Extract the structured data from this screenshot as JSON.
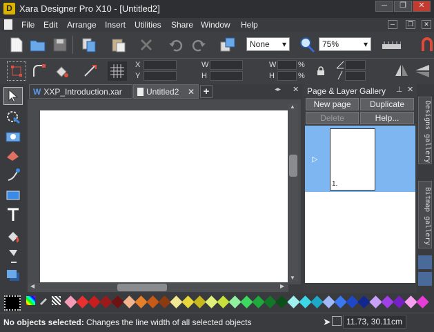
{
  "window": {
    "title": "Xara Designer Pro X10 - [Untitled2]",
    "app_icon": "D",
    "minimize": "─",
    "restore": "❐",
    "close": "✕",
    "inner_minimize": "─",
    "inner_restore": "❐",
    "inner_close": "✕"
  },
  "menu": [
    "File",
    "Edit",
    "Arrange",
    "Insert",
    "Utilities",
    "Share",
    "Window",
    "Help"
  ],
  "toolbar": {
    "quality_value": "None",
    "zoom_value": "75%"
  },
  "infobar": {
    "x_label": "X",
    "y_label": "Y",
    "w_label": "W",
    "h_label": "H",
    "w2_label": "W",
    "h2_label": "H",
    "pct1": "%",
    "pct2": "%"
  },
  "tabs": [
    {
      "label": "XXP_Introduction.xar",
      "icon": "W"
    },
    {
      "label": "Untitled2"
    }
  ],
  "tab_close": "✕",
  "tab_add": "+",
  "gallery": {
    "title": "Page & Layer Gallery",
    "new_page": "New page",
    "duplicate": "Duplicate",
    "delete": "Delete",
    "help": "Help...",
    "page_number": "1."
  },
  "vtabs": [
    "Designs gallery",
    "Bitmap gallery"
  ],
  "status": {
    "bold": "No objects selected:",
    "text": " Changes the line width of all selected objects",
    "coords": "11.73, 30.11cm"
  },
  "palette": [
    "#f49bb8",
    "#e83030",
    "#c81e1e",
    "#9c1a1a",
    "#6e1212",
    "#f2b48c",
    "#e8802a",
    "#c85a18",
    "#8c3a10",
    "#f2e894",
    "#e8d83c",
    "#c8b81e",
    "#e0f07a",
    "#c8e03c",
    "#90f0a0",
    "#3cd860",
    "#1eaa3c",
    "#127828",
    "#0a5018",
    "#a0f0f0",
    "#3cd8e8",
    "#1ea8c8",
    "#a0b8f8",
    "#3c78f0",
    "#1e48c8",
    "#122890",
    "#c8a0f8",
    "#a040e8",
    "#7820c8",
    "#f8a0f0",
    "#e83cd8"
  ],
  "icons": {
    "new": "new-document-icon",
    "open": "open-folder-icon",
    "save": "save-icon"
  }
}
